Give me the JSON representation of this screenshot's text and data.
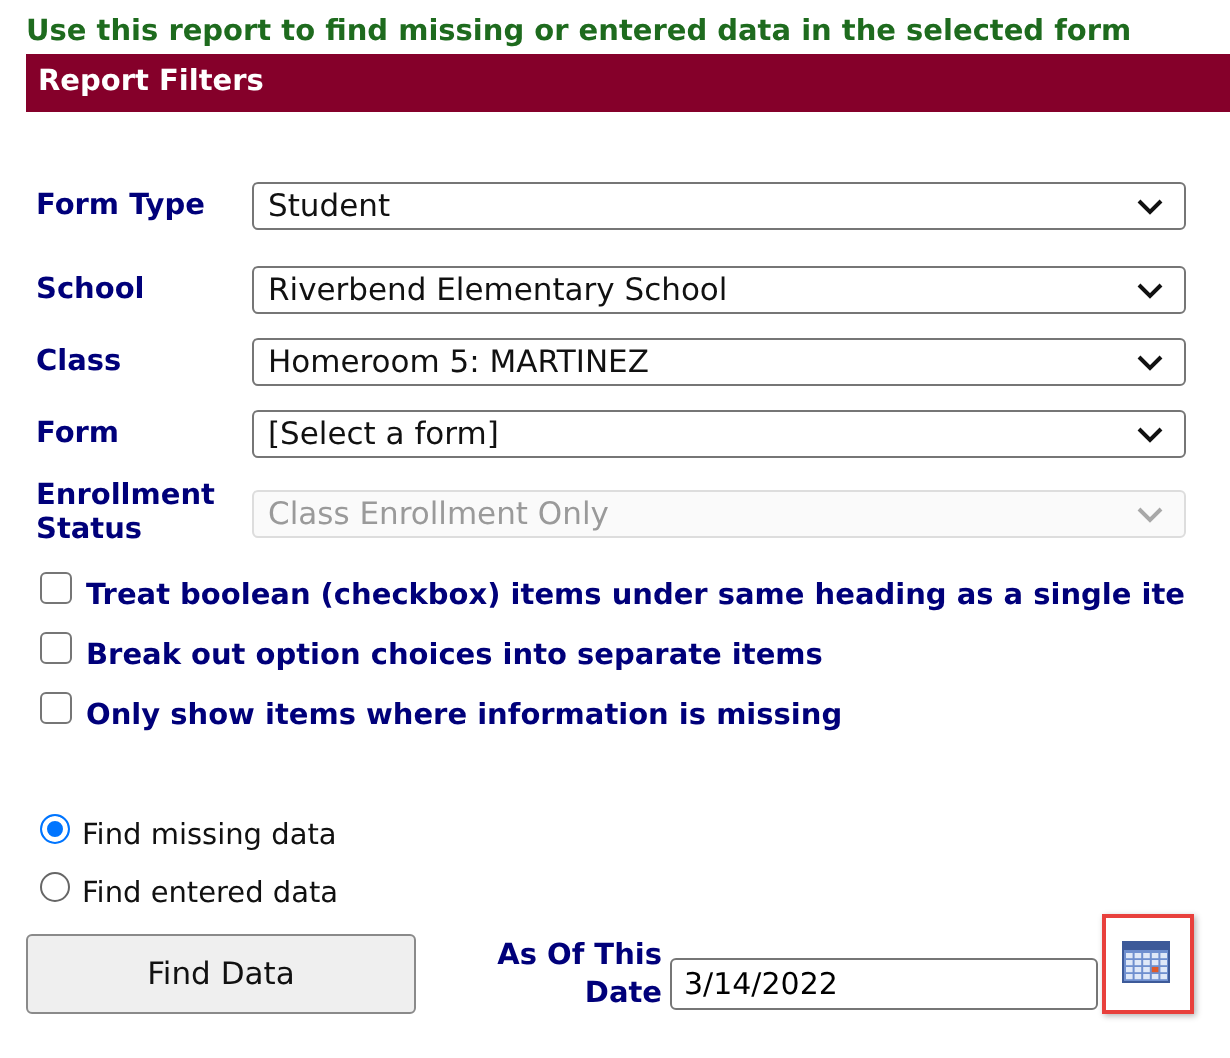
{
  "intro": "Use this report to find missing or entered data in the selected form",
  "panel": {
    "title": "Report Filters"
  },
  "fields": [
    {
      "label": "Form Type",
      "value": "Student",
      "disabled": false
    },
    {
      "label": "School",
      "value": "Riverbend Elementary School",
      "disabled": false
    },
    {
      "label": "Class",
      "value": "Homeroom 5: MARTINEZ",
      "disabled": false
    },
    {
      "label": "Form",
      "value": "[Select a form]",
      "disabled": false
    },
    {
      "label": "Enrollment Status",
      "value": "Class Enrollment Only",
      "disabled": true
    }
  ],
  "options": [
    {
      "label": "Treat boolean (checkbox) items under same heading as a single ite",
      "checked": false
    },
    {
      "label": "Break out option choices into separate items",
      "checked": false
    },
    {
      "label": "Only show items where information is missing",
      "checked": false
    }
  ],
  "modes": [
    {
      "label": "Find missing data",
      "selected": true
    },
    {
      "label": "Find entered data",
      "selected": false
    }
  ],
  "find_button": "Find Data",
  "date": {
    "label": "As Of This Date",
    "value": "3/14/2022",
    "highlighted": true
  }
}
